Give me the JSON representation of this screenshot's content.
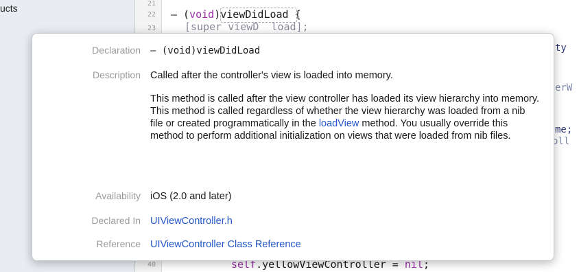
{
  "navigator": {
    "label": "ucts"
  },
  "editor": {
    "line_numbers": [
      "21",
      "22",
      "23",
      "40"
    ],
    "lines": {
      "l22_prefix": "– (",
      "l22_keyword": "void",
      "l22_rest": ")viewDidLoad {",
      "l23": "[super viewD  load];",
      "l40_self": "self",
      "l40_rest": ".yellowViewController = ",
      "l40_nil": "nil",
      "l40_end": ";"
    },
    "right_fragments": [
      "ty",
      "erW",
      "me;",
      "oll"
    ]
  },
  "popover": {
    "rows": [
      {
        "label": "Declaration",
        "value": "– (void)viewDidLoad"
      },
      {
        "label": "Description",
        "summary": "Called after the controller's view is loaded into memory.",
        "detail_before": "This method is called after the view controller has loaded its view hierarchy into memory. This method is called regardless of whether the view hierarchy was loaded from a nib file or created programmatically in the ",
        "detail_link": "loadView",
        "detail_after": " method. You usually override this method to perform additional initialization on views that were loaded from nib files."
      },
      {
        "label": "Availability",
        "value": "iOS (2.0 and later)"
      },
      {
        "label": "Declared In",
        "value": "UIViewController.h"
      },
      {
        "label": "Reference",
        "value": "UIViewController Class Reference"
      }
    ]
  },
  "colors": {
    "link": "#2356c6",
    "label": "#9b9b9b",
    "keyword": "#9a2ea8"
  }
}
